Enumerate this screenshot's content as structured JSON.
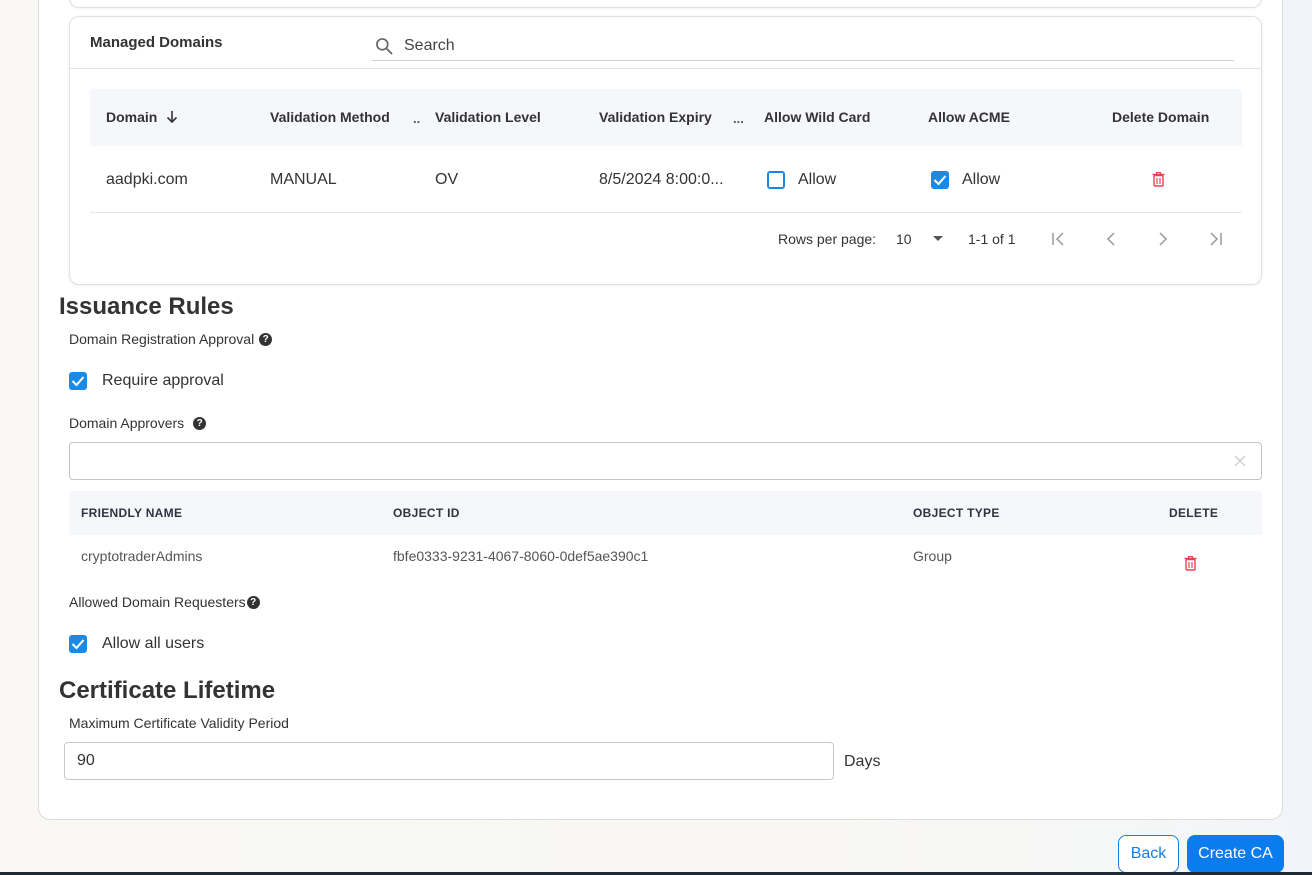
{
  "managed_domains": {
    "title": "Managed Domains",
    "search_placeholder": "Search",
    "columns": [
      {
        "label": "Domain"
      },
      {
        "label": "Validation Method"
      },
      {
        "label": "Validation Level"
      },
      {
        "label": "Validation Expiry"
      },
      {
        "label": "Allow Wild Card"
      },
      {
        "label": "Allow ACME"
      },
      {
        "label": "Delete Domain"
      }
    ],
    "column_menu_glyph": "..",
    "column_menu_glyph_long": "...",
    "rows": [
      {
        "domain": "aadpki.com",
        "validation_method": "MANUAL",
        "validation_level": "OV",
        "validation_expiry": "8/5/2024 8:00:0...",
        "allow_wildcard": {
          "checked": false,
          "label": "Allow"
        },
        "allow_acme": {
          "checked": true,
          "label": "Allow"
        }
      }
    ],
    "pagination": {
      "rows_per_page_label": "Rows per page:",
      "rows_per_page": "10",
      "range": "1-1 of 1"
    }
  },
  "issuance_rules": {
    "title": "Issuance Rules",
    "domain_registration_approval_label": "Domain Registration Approval",
    "require_approval": {
      "checked": true,
      "label": "Require approval"
    },
    "domain_approvers_label": "Domain Approvers",
    "approvers_input_value": "",
    "approvers_table": {
      "columns": [
        "FRIENDLY NAME",
        "OBJECT ID",
        "OBJECT TYPE",
        "DELETE"
      ],
      "rows": [
        {
          "friendly_name": "cryptotraderAdmins",
          "object_id": "fbfe0333-9231-4067-8060-0def5ae390c1",
          "object_type": "Group"
        }
      ]
    },
    "allowed_domain_requesters_label": "Allowed Domain Requesters",
    "allow_all_users": {
      "checked": true,
      "label": "Allow all users"
    }
  },
  "certificate_lifetime": {
    "title": "Certificate Lifetime",
    "max_validity_label": "Maximum Certificate Validity Period",
    "max_validity_value": "90",
    "unit_label": "Days"
  },
  "footer": {
    "back_label": "Back",
    "create_label": "Create CA"
  },
  "icons": {
    "help": "?",
    "search": "search-icon",
    "sort_desc": "arrow-down-icon",
    "delete": "trash-icon",
    "clear": "close-icon"
  },
  "colors": {
    "accent": "#1a8ae6",
    "primary_button": "#0a7cf0",
    "delete": "#e8414f"
  }
}
